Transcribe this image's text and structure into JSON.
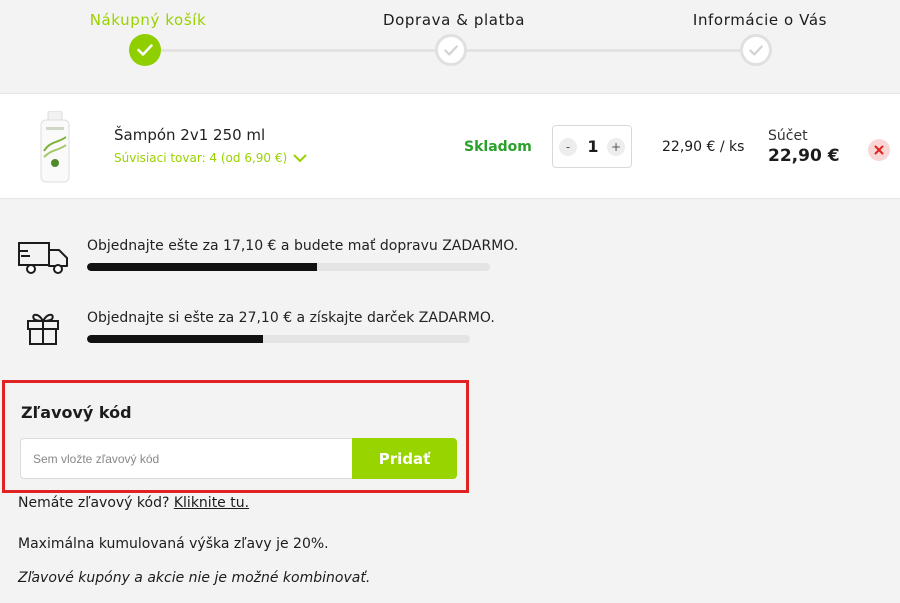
{
  "steps": [
    {
      "label": "Nákupný košík",
      "state": "done"
    },
    {
      "label": "Doprava & platba",
      "state": "todo"
    },
    {
      "label": "Informácie o Vás",
      "state": "todo"
    }
  ],
  "cart": {
    "product_name": "Šampón 2v1 250 ml",
    "related_label": "Súvisiaci tovar: 4 (od 6,90 €)",
    "stock": "Skladom",
    "quantity": "1",
    "qty_minus": "-",
    "qty_plus": "+",
    "unit_price": "22,90 € / ks",
    "sum_label": "Súčet",
    "sum_value": "22,90 €"
  },
  "promos": {
    "shipping": {
      "text": "Objednajte ešte za 17,10 € a budete mať dopravu ZADARMO.",
      "progress": 0.57
    },
    "gift": {
      "text": "Objednajte si ešte za 27,10 € a získajte darček ZADARMO.",
      "progress": 0.46
    }
  },
  "coupon": {
    "title": "Zľavový kód",
    "placeholder": "Sem vložte zľavový kód",
    "button": "Pridať"
  },
  "notes": {
    "no_code": "Nemáte zľavový kód?",
    "no_code_link": "Kliknite tu.",
    "max_discount": "Maximálna kumulovaná výška zľavy je 20%.",
    "combine": "Zľavové kupóny a akcie nie je možné kombinovať."
  },
  "colors": {
    "accent": "#98d400",
    "stock": "#2aa12a",
    "remove": "#e02222"
  }
}
